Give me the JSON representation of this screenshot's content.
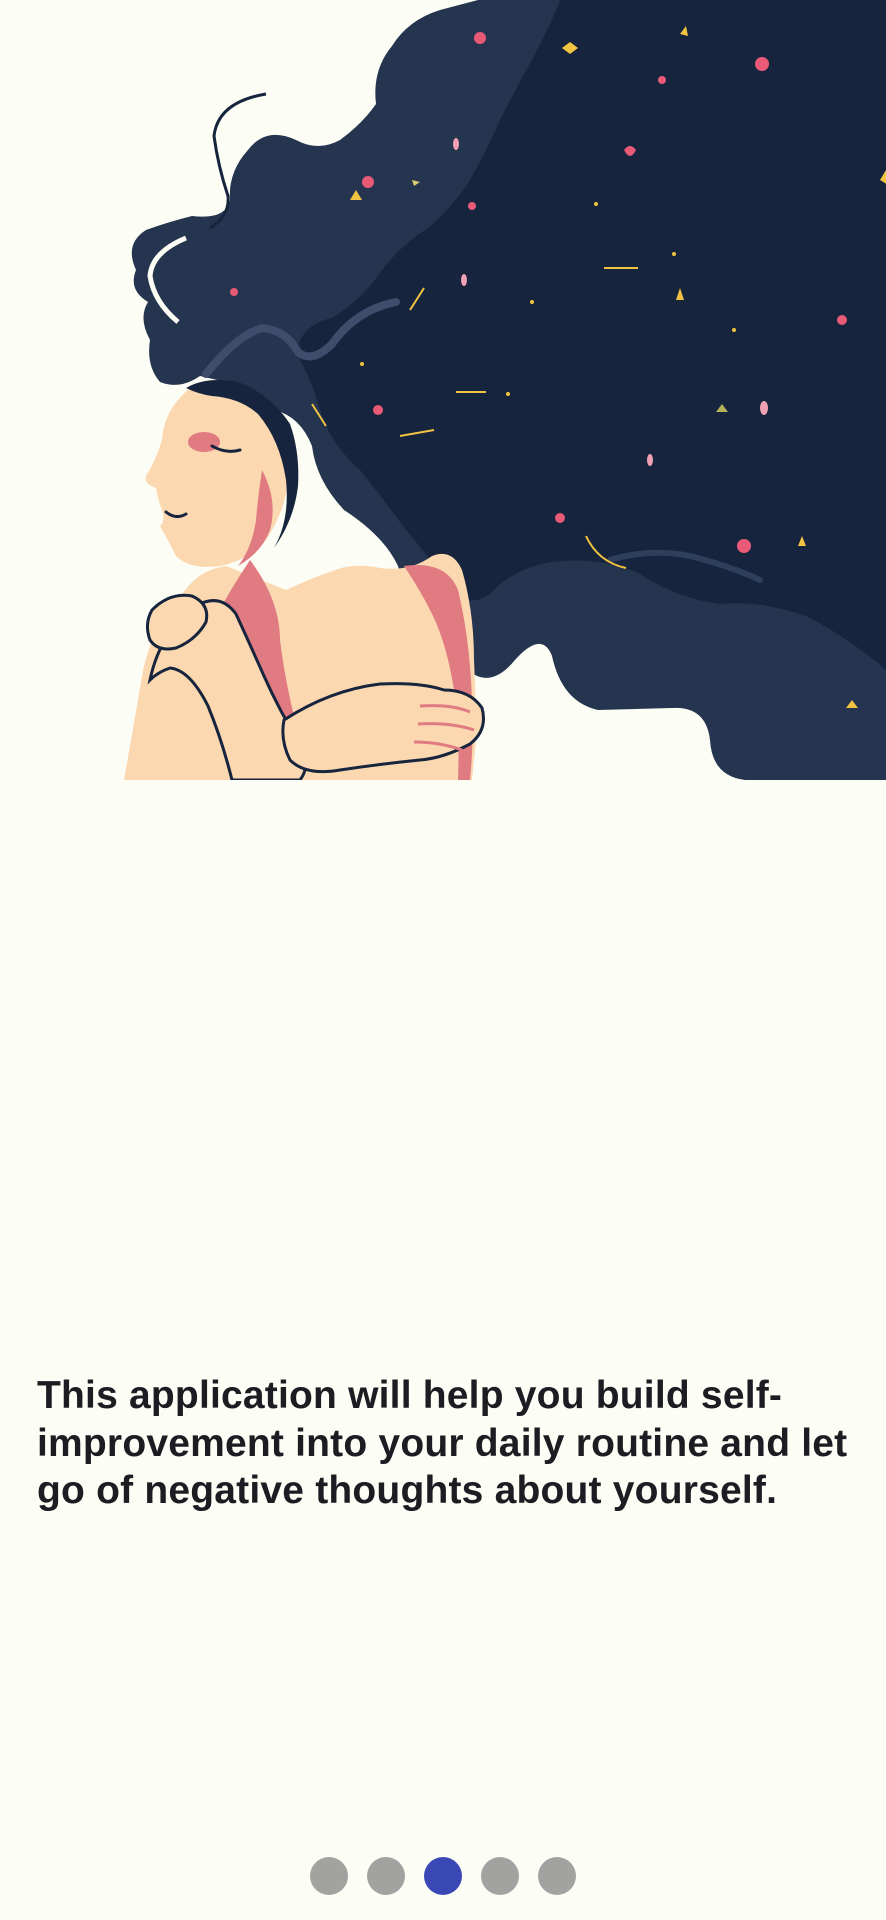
{
  "onboarding": {
    "illustration": "woman-hugging-herself-flowing-hair",
    "description": "This application will help you build self-improvement into your daily routine and let go of negative thoughts about yourself.",
    "pager": {
      "total": 5,
      "current": 3
    }
  },
  "colors": {
    "background": "#fcfdf4",
    "hair_dark": "#16243d",
    "hair_light": "#25354f",
    "skin": "#fcd8b0",
    "skin_shadow": "#e07b82",
    "text": "#1c1c22",
    "dot_inactive": "#a2a3a0",
    "dot_active": "#3a48b6"
  }
}
